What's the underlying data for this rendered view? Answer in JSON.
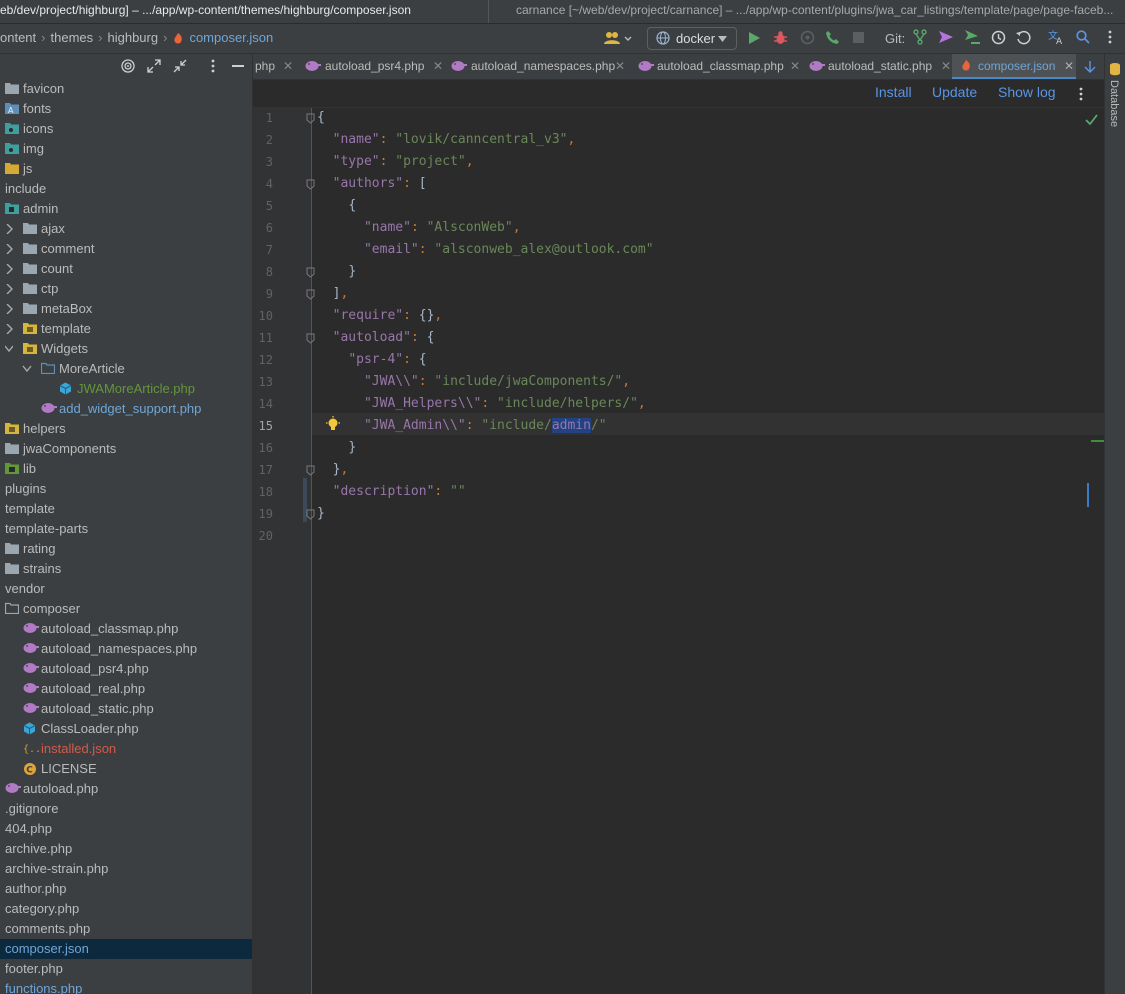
{
  "titlebar": {
    "left": "eb/dev/project/highburg] – .../app/wp-content/themes/highburg/composer.json",
    "right": "carnance [~/web/dev/project/carnance] – .../app/wp-content/plugins/jwa_car_listings/template/page/page-faceb..."
  },
  "breadcrumbs": [
    "ontent",
    "themes",
    "highburg",
    "composer.json"
  ],
  "toolbar": {
    "run_config": "docker",
    "git_label": "Git:"
  },
  "tree": [
    {
      "label": "favicon",
      "icon": "folder-icon",
      "x": 5,
      "color": "#bbbbbb"
    },
    {
      "label": "fonts",
      "icon": "font-folder-icon",
      "x": 5,
      "color": "#bbbbbb"
    },
    {
      "label": "icons",
      "icon": "image-folder-icon",
      "x": 5,
      "color": "#bbbbbb"
    },
    {
      "label": "img",
      "icon": "image-folder-icon",
      "x": 5,
      "color": "#bbbbbb"
    },
    {
      "label": "js",
      "icon": "js-folder-icon",
      "x": 5,
      "color": "#bbbbbb"
    },
    {
      "label": "include",
      "icon": "none",
      "x": 5,
      "color": "#bbbbbb"
    },
    {
      "label": "admin",
      "icon": "module-folder-icon",
      "x": 5,
      "color": "#bbbbbb"
    },
    {
      "label": "ajax",
      "icon": "folder-icon",
      "x": 23,
      "color": "#bbbbbb"
    },
    {
      "label": "comment",
      "icon": "folder-icon",
      "x": 23,
      "color": "#bbbbbb"
    },
    {
      "label": "count",
      "icon": "folder-icon",
      "x": 23,
      "color": "#bbbbbb"
    },
    {
      "label": "ctp",
      "icon": "folder-icon",
      "x": 23,
      "color": "#bbbbbb"
    },
    {
      "label": "metaBox",
      "icon": "folder-icon",
      "x": 23,
      "color": "#bbbbbb"
    },
    {
      "label": "template",
      "icon": "yellow-folder-icon",
      "x": 23,
      "color": "#bbbbbb"
    },
    {
      "label": "Widgets",
      "icon": "yellow-folder-icon",
      "x": 23,
      "color": "#bbbbbb"
    },
    {
      "label": "MoreArticle",
      "icon": "package-folder-icon",
      "x": 41,
      "color": "#bbbbbb"
    },
    {
      "label": "JWAMoreArticle.php",
      "icon": "class-icon",
      "x": 59,
      "color": "#62973a"
    },
    {
      "label": "add_widget_support.php",
      "icon": "php-icon",
      "x": 41,
      "color": "#6ea6d8"
    },
    {
      "label": "helpers",
      "icon": "yellow-folder-icon",
      "x": 5,
      "color": "#bbbbbb"
    },
    {
      "label": "jwaComponents",
      "icon": "folder-icon",
      "x": 5,
      "color": "#bbbbbb"
    },
    {
      "label": "lib",
      "icon": "lib-folder-icon",
      "x": 5,
      "color": "#bbbbbb"
    },
    {
      "label": "plugins",
      "icon": "none",
      "x": 5,
      "color": "#bbbbbb"
    },
    {
      "label": "template",
      "icon": "none",
      "x": 5,
      "color": "#bbbbbb"
    },
    {
      "label": "template-parts",
      "icon": "none",
      "x": 5,
      "color": "#bbbbbb"
    },
    {
      "label": "rating",
      "icon": "folder-icon",
      "x": 5,
      "color": "#bbbbbb"
    },
    {
      "label": "strains",
      "icon": "folder-icon",
      "x": 5,
      "color": "#bbbbbb"
    },
    {
      "label": "vendor",
      "icon": "none",
      "x": 5,
      "color": "#bbbbbb"
    },
    {
      "label": "composer",
      "icon": "open-folder-icon",
      "x": 5,
      "color": "#bbbbbb"
    },
    {
      "label": "autoload_classmap.php",
      "icon": "php-icon",
      "x": 23,
      "color": "#bbbbbb"
    },
    {
      "label": "autoload_namespaces.php",
      "icon": "php-icon",
      "x": 23,
      "color": "#bbbbbb"
    },
    {
      "label": "autoload_psr4.php",
      "icon": "php-icon",
      "x": 23,
      "color": "#bbbbbb"
    },
    {
      "label": "autoload_real.php",
      "icon": "php-icon",
      "x": 23,
      "color": "#bbbbbb"
    },
    {
      "label": "autoload_static.php",
      "icon": "php-icon",
      "x": 23,
      "color": "#bbbbbb"
    },
    {
      "label": "ClassLoader.php",
      "icon": "class-icon",
      "x": 23,
      "color": "#bbbbbb"
    },
    {
      "label": "installed.json",
      "icon": "json-icon",
      "x": 23,
      "color": "#d45a4a"
    },
    {
      "label": "LICENSE",
      "icon": "copyright-icon",
      "x": 23,
      "color": "#bbbbbb"
    },
    {
      "label": "autoload.php",
      "icon": "php-icon",
      "x": 5,
      "color": "#bbbbbb"
    },
    {
      "label": ".gitignore",
      "icon": "none",
      "x": 5,
      "color": "#bbbbbb"
    },
    {
      "label": "404.php",
      "icon": "none",
      "x": 5,
      "color": "#bbbbbb"
    },
    {
      "label": "archive.php",
      "icon": "none",
      "x": 5,
      "color": "#bbbbbb"
    },
    {
      "label": "archive-strain.php",
      "icon": "none",
      "x": 5,
      "color": "#bbbbbb"
    },
    {
      "label": "author.php",
      "icon": "none",
      "x": 5,
      "color": "#bbbbbb"
    },
    {
      "label": "category.php",
      "icon": "none",
      "x": 5,
      "color": "#bbbbbb"
    },
    {
      "label": "comments.php",
      "icon": "none",
      "x": 5,
      "color": "#bbbbbb"
    },
    {
      "label": "composer.json",
      "icon": "none",
      "x": 5,
      "color": "#6ea6d8",
      "selected": true
    },
    {
      "label": "footer.php",
      "icon": "none",
      "x": 5,
      "color": "#bbbbbb"
    },
    {
      "label": "functions.php",
      "icon": "none",
      "x": 5,
      "color": "#6ea6d8"
    }
  ],
  "tabs": [
    {
      "label": "php"
    },
    {
      "label": "autoload_psr4.php"
    },
    {
      "label": "autoload_namespaces.php"
    },
    {
      "label": "autoload_classmap.php"
    },
    {
      "label": "autoload_static.php"
    },
    {
      "label": "composer.json",
      "active": true
    }
  ],
  "actions": {
    "install": "Install",
    "update": "Update",
    "show_log": "Show log"
  },
  "right_panel": {
    "database": "Database"
  },
  "editor": {
    "current_line": 15,
    "lines": [
      [
        [
          "br",
          "{"
        ]
      ],
      [
        [
          "sp",
          "  "
        ],
        [
          "k",
          "\"name\""
        ],
        [
          "p",
          ": "
        ],
        [
          "s",
          "\"lovik/canncentral_v3\""
        ],
        [
          "p",
          ","
        ]
      ],
      [
        [
          "sp",
          "  "
        ],
        [
          "k",
          "\"type\""
        ],
        [
          "p",
          ": "
        ],
        [
          "s",
          "\"project\""
        ],
        [
          "p",
          ","
        ]
      ],
      [
        [
          "sp",
          "  "
        ],
        [
          "k",
          "\"authors\""
        ],
        [
          "p",
          ": "
        ],
        [
          "br",
          "["
        ]
      ],
      [
        [
          "sp",
          "    "
        ],
        [
          "br",
          "{"
        ]
      ],
      [
        [
          "sp",
          "      "
        ],
        [
          "k",
          "\"name\""
        ],
        [
          "p",
          ": "
        ],
        [
          "s",
          "\"AlsconWeb\""
        ],
        [
          "p",
          ","
        ]
      ],
      [
        [
          "sp",
          "      "
        ],
        [
          "k",
          "\"email\""
        ],
        [
          "p",
          ": "
        ],
        [
          "s",
          "\"alsconweb_alex@outlook.com\""
        ]
      ],
      [
        [
          "sp",
          "    "
        ],
        [
          "br",
          "}"
        ]
      ],
      [
        [
          "sp",
          "  "
        ],
        [
          "br",
          "]"
        ],
        [
          "p",
          ","
        ]
      ],
      [
        [
          "sp",
          "  "
        ],
        [
          "k",
          "\"require\""
        ],
        [
          "p",
          ": "
        ],
        [
          "br",
          "{}"
        ],
        [
          "p",
          ","
        ]
      ],
      [
        [
          "sp",
          "  "
        ],
        [
          "k",
          "\"autoload\""
        ],
        [
          "p",
          ": "
        ],
        [
          "br",
          "{"
        ]
      ],
      [
        [
          "sp",
          "    "
        ],
        [
          "k",
          "\"psr-4\""
        ],
        [
          "p",
          ": "
        ],
        [
          "br",
          "{"
        ]
      ],
      [
        [
          "sp",
          "      "
        ],
        [
          "k",
          "\"JWA\\\\\""
        ],
        [
          "p",
          ": "
        ],
        [
          "s",
          "\"include/jwaComponents/\""
        ],
        [
          "p",
          ","
        ]
      ],
      [
        [
          "sp",
          "      "
        ],
        [
          "k",
          "\"JWA_Helpers\\\\\""
        ],
        [
          "p",
          ": "
        ],
        [
          "s",
          "\"include/helpers/\""
        ],
        [
          "p",
          ","
        ]
      ],
      [
        [
          "sp",
          "      "
        ],
        [
          "k",
          "\"JWA_Admin\\\\\""
        ],
        [
          "p",
          ": "
        ],
        [
          "s",
          "\"include/"
        ],
        [
          "hl",
          "admin"
        ],
        [
          "s",
          "/\""
        ]
      ],
      [
        [
          "sp",
          "    "
        ],
        [
          "br",
          "}"
        ]
      ],
      [
        [
          "sp",
          "  "
        ],
        [
          "br",
          "}"
        ],
        [
          "p",
          ","
        ]
      ],
      [
        [
          "sp",
          "  "
        ],
        [
          "k",
          "\"description\""
        ],
        [
          "p",
          ": "
        ],
        [
          "s",
          "\"\""
        ]
      ],
      [
        [
          "br",
          "}"
        ]
      ],
      []
    ]
  }
}
